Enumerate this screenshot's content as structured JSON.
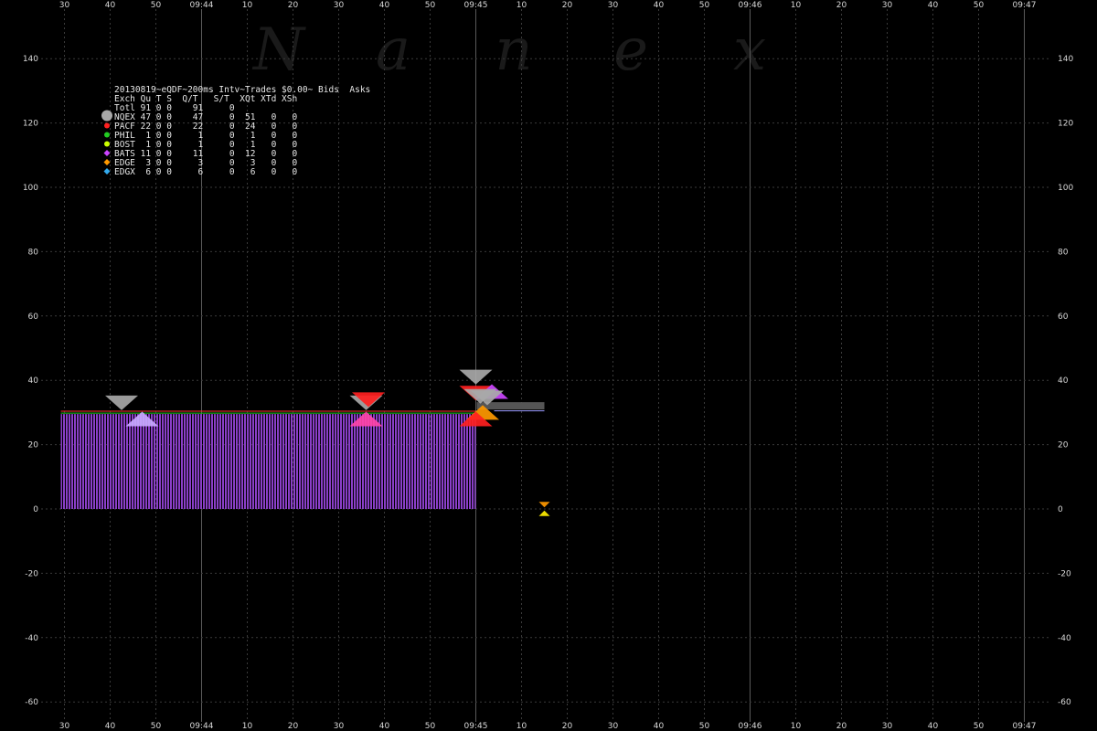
{
  "chart_data": {
    "type": "scatter",
    "watermark": [
      "N",
      "a",
      "n",
      "e",
      "x"
    ],
    "x_tick_labels": [
      "30",
      "40",
      "50",
      "09:44",
      "10",
      "20",
      "30",
      "40",
      "50",
      "09:45",
      "10",
      "20",
      "30",
      "40",
      "50",
      "09:46",
      "10",
      "20",
      "30",
      "40",
      "50",
      "09:47"
    ],
    "x_major_labels": [
      "09:44",
      "09:45",
      "09:46",
      "09:47"
    ],
    "y_ticks": [
      140,
      120,
      100,
      80,
      60,
      40,
      20,
      0,
      -20,
      -40,
      -60
    ],
    "ylim": [
      -62,
      152
    ],
    "legend_title": "20130819~eQDF~200ms Intv~Trades $0.00~ Bids  Asks",
    "legend_header": "Exch Qu T S  Q/T   S/T  XQt XTd XSh",
    "legend_rows": [
      {
        "text": "Totl 91 0 0    91     0",
        "color": "",
        "marker": "none"
      },
      {
        "text": "NQEX 47 0 0    47     0  51   0   0",
        "color": "#a8a8a8",
        "marker": "hexagon"
      },
      {
        "text": "PACF 22 0 0    22     0  24   0   0",
        "color": "#ff2020",
        "marker": "dot"
      },
      {
        "text": "PHIL  1 0 0     1     0   1   0   0",
        "color": "#22cc22",
        "marker": "dot"
      },
      {
        "text": "BOST  1 0 0     1     0   1   0   0",
        "color": "#ccff00",
        "marker": "dot"
      },
      {
        "text": "BATS 11 0 0    11     0  12   0   0",
        "color": "#cc44ff",
        "marker": "diamond"
      },
      {
        "text": "EDGE  3 0 0     3     0   3   0   0",
        "color": "#ff9900",
        "marker": "diamond"
      },
      {
        "text": "EDGX  6 0 0     6     0   6   0   0",
        "color": "#33aaee",
        "marker": "diamond"
      }
    ],
    "colors": {
      "nbbo_fill": "#8a3fc8",
      "bid_line": "#22cc22",
      "ask_line": "#ff3030",
      "gray": "#a8a8a8",
      "red": "#ff2020",
      "pink": "#ff44aa",
      "lavender": "#c8a8ff",
      "purple": "#cc44ff",
      "orange": "#ff9900",
      "yellow": "#ffee00"
    },
    "markers": [
      {
        "x": 42.5,
        "y": 33,
        "kind": "down",
        "color": "#a8a8a8"
      },
      {
        "x": 47,
        "y": 28,
        "kind": "up",
        "color": "#c8a8ff"
      },
      {
        "x": 96,
        "y": 33,
        "kind": "down",
        "color": "#a8a8a8"
      },
      {
        "x": 96.5,
        "y": 34,
        "kind": "down",
        "color": "#ff2020"
      },
      {
        "x": 96,
        "y": 28,
        "kind": "up",
        "color": "#ff44aa"
      },
      {
        "x": 120,
        "y": 41,
        "kind": "down",
        "color": "#a8a8a8"
      },
      {
        "x": 120,
        "y": 36,
        "kind": "down",
        "color": "#ff2020"
      },
      {
        "x": 123.5,
        "y": 36.5,
        "kind": "up",
        "color": "#cc44ff"
      },
      {
        "x": 121,
        "y": 35,
        "kind": "down",
        "color": "#a8a8a8"
      },
      {
        "x": 122.5,
        "y": 34.5,
        "kind": "down",
        "color": "#a8a8a8"
      },
      {
        "x": 121.5,
        "y": 30,
        "kind": "up",
        "color": "#ff9900"
      },
      {
        "x": 120,
        "y": 28,
        "kind": "up",
        "color": "#ff2020"
      },
      {
        "x": 135,
        "y": 0.5,
        "kind": "down",
        "color": "#ff9900"
      },
      {
        "x": 135,
        "y": -0.5,
        "kind": "up",
        "color": "#ffee00"
      }
    ]
  }
}
